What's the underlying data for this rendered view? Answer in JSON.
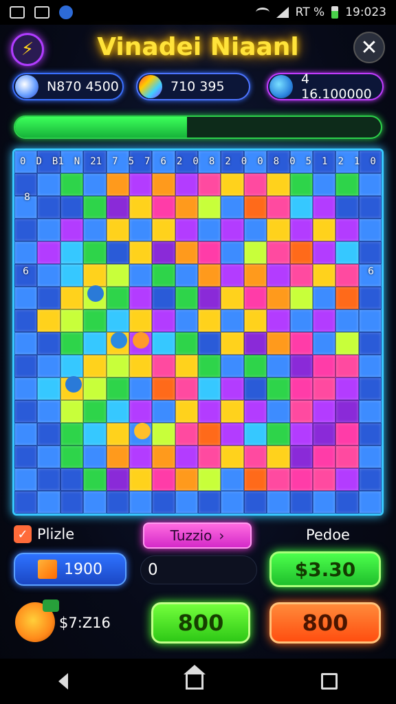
{
  "status_bar": {
    "network_text": "RT %",
    "time": "19:023"
  },
  "header": {
    "title": "Vinadei Niaanl"
  },
  "currencies": [
    {
      "value": "N870 4500",
      "icon": "blue-coin-icon"
    },
    {
      "value": "710 395",
      "icon": "rainbow-gem-icon"
    },
    {
      "value": "4 16.100000",
      "icon": "blue-fish-icon"
    }
  ],
  "progress": {
    "value": 0.47,
    "color": "#2dd14a"
  },
  "board": {
    "top_numbers": [
      "0",
      "D",
      "B1",
      "N",
      "21",
      "7",
      "5",
      "7",
      "6",
      "2",
      "0",
      "8",
      "2",
      "0",
      "0",
      "8",
      "0",
      "5",
      "1",
      "2",
      "1",
      "0"
    ],
    "side_marks": [
      "8",
      "6",
      "6"
    ],
    "colors": [
      "#2a5bd8",
      "#3d8cff",
      "#36c8ff",
      "#ff9a1c",
      "#ff6a1a",
      "#ffd21c",
      "#c8ff3a",
      "#2ed44a",
      "#ff3ca8",
      "#b33cff",
      "#8a2ad8",
      "#ff4aa0"
    ]
  },
  "controls": {
    "puzzle_label": "Plizle",
    "tab_label": "Tuzzio",
    "tab_arrow": "›",
    "pedoe_label": "Pedoe",
    "blue_button_value": "1900",
    "input_value": "0",
    "price_button": "$3.30",
    "money_label": "$7:Z16",
    "green_button": "800",
    "orange_button": "800"
  }
}
